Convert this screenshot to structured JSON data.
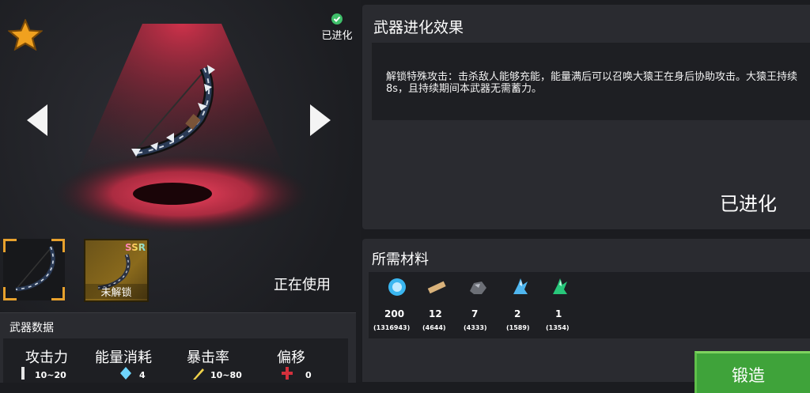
{
  "weapon_view": {
    "evolved_badge": "已进化",
    "in_use_label": "正在使用",
    "skin_slots": [
      {
        "rarity": "",
        "locked_label": ""
      },
      {
        "rarity": "SSR",
        "locked_label": "未解锁"
      }
    ]
  },
  "weapon_stats": {
    "title": "武器数据",
    "items": [
      {
        "label": "攻击力",
        "value": "10~20",
        "icon": "sword-icon"
      },
      {
        "label": "能量消耗",
        "value": "4",
        "icon": "energy-crystal-icon"
      },
      {
        "label": "暴击率",
        "value": "10~80",
        "icon": "crit-icon"
      },
      {
        "label": "偏移",
        "value": "0",
        "icon": "crosshair-icon"
      }
    ]
  },
  "evolution": {
    "title": "武器进化效果",
    "description": "解锁特殊攻击：击杀敌人能够充能，能量满后可以召唤大猿王在身后协助攻击。大猿王持续8s，且持续期间本武器无需蓄力。",
    "status": "已进化"
  },
  "materials": {
    "title": "所需材料",
    "items": [
      {
        "icon": "blue-gem-coin-icon",
        "required": "200",
        "owned": "(1316943)"
      },
      {
        "icon": "wood-plank-icon",
        "required": "12",
        "owned": "(4644)"
      },
      {
        "icon": "ore-stone-icon",
        "required": "7",
        "owned": "(4333)"
      },
      {
        "icon": "blue-crystal-icon",
        "required": "2",
        "owned": "(1589)"
      },
      {
        "icon": "green-crystal-icon",
        "required": "1",
        "owned": "(1354)"
      }
    ]
  },
  "forge_button": {
    "label": "锻造"
  },
  "colors": {
    "accent_orange": "#e7a12d",
    "forge_green": "#3fa33a",
    "spotlight_red": "#e0334e"
  }
}
